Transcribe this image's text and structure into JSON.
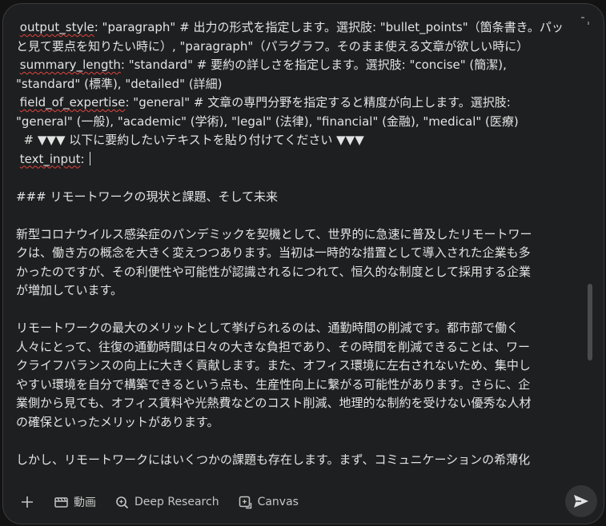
{
  "editor": {
    "lines": [
      {
        "indent": "",
        "key": "",
        "text": ""
      },
      {
        "indent": " ",
        "key": "output_style",
        "text": ": \"paragraph\" # 出力の形式を指定します。選択肢: \"bullet_points\"（箇条書き。パッ"
      },
      {
        "indent": "",
        "key": "",
        "text": "と見て要点を知りたい時に）, \"paragraph\"（パラグラフ。そのまま使える文章が欲しい時に）"
      },
      {
        "indent": " ",
        "key": "summary_length",
        "text": ": \"standard\" # 要約の詳しさを指定します。選択肢: \"concise\" (簡潔),"
      },
      {
        "indent": "",
        "key": "",
        "text": "\"standard\" (標準), \"detailed\" (詳細)"
      },
      {
        "indent": " ",
        "key": "field_of_expertise",
        "text": ": \"general\" # 文章の専門分野を指定すると精度が向上します。選択肢:"
      },
      {
        "indent": "",
        "key": "",
        "text": "\"general\" (一般), \"academic\" (学術), \"legal\" (法律), \"financial\" (金融), \"medical\" (医療)"
      },
      {
        "indent": "  ",
        "key": "",
        "text": "# ▼▼▼ 以下に要約したいテキストを貼り付けてください ▼▼▼"
      },
      {
        "indent": " ",
        "key": "text_input",
        "text": ": "
      },
      {
        "indent": "",
        "key": "",
        "text": ""
      },
      {
        "indent": "",
        "key": "",
        "text": "### リモートワークの現状と課題、そして未来"
      },
      {
        "indent": "",
        "key": "",
        "text": ""
      },
      {
        "indent": "",
        "key": "",
        "text": "新型コロナウイルス感染症のパンデミックを契機として、世界的に急速に普及したリモートワー"
      },
      {
        "indent": "",
        "key": "",
        "text": "クは、働き方の概念を大きく変えつつあります。当初は一時的な措置として導入された企業も多"
      },
      {
        "indent": "",
        "key": "",
        "text": "かったのですが、その利便性や可能性が認識されるにつれて、恒久的な制度として採用する企業"
      },
      {
        "indent": "",
        "key": "",
        "text": "が増加しています。"
      },
      {
        "indent": "",
        "key": "",
        "text": ""
      },
      {
        "indent": "",
        "key": "",
        "text": "リモートワークの最大のメリットとして挙げられるのは、通勤時間の削減です。都市部で働く"
      },
      {
        "indent": "",
        "key": "",
        "text": "人々にとって、往復の通勤時間は日々の大きな負担であり、その時間を削減できることは、ワー"
      },
      {
        "indent": "",
        "key": "",
        "text": "クライフバランスの向上に大きく貢献します。また、オフィス環境に左右されないため、集中し"
      },
      {
        "indent": "",
        "key": "",
        "text": "やすい環境を自分で構築できるという点も、生産性向上に繋がる可能性があります。さらに、企"
      },
      {
        "indent": "",
        "key": "",
        "text": "業側から見ても、オフィス賃料や光熱費などのコスト削減、地理的な制約を受けない優秀な人材"
      },
      {
        "indent": "",
        "key": "",
        "text": "の確保といったメリットがあります。"
      },
      {
        "indent": "",
        "key": "",
        "text": ""
      },
      {
        "indent": "",
        "key": "",
        "text": "しかし、リモートワークにはいくつかの課題も存在します。まず、コミュニケーションの希薄化"
      }
    ]
  },
  "toolbar": {
    "plus_icon": "plus-icon",
    "video_label": "動画",
    "deep_research_label": "Deep Research",
    "canvas_label": "Canvas",
    "send_icon": "send-icon"
  },
  "colors": {
    "background": "#1e1f20",
    "text": "#e3e3e3",
    "spellcheck": "#e0453f",
    "toolbar_text": "#c4c7c5"
  }
}
